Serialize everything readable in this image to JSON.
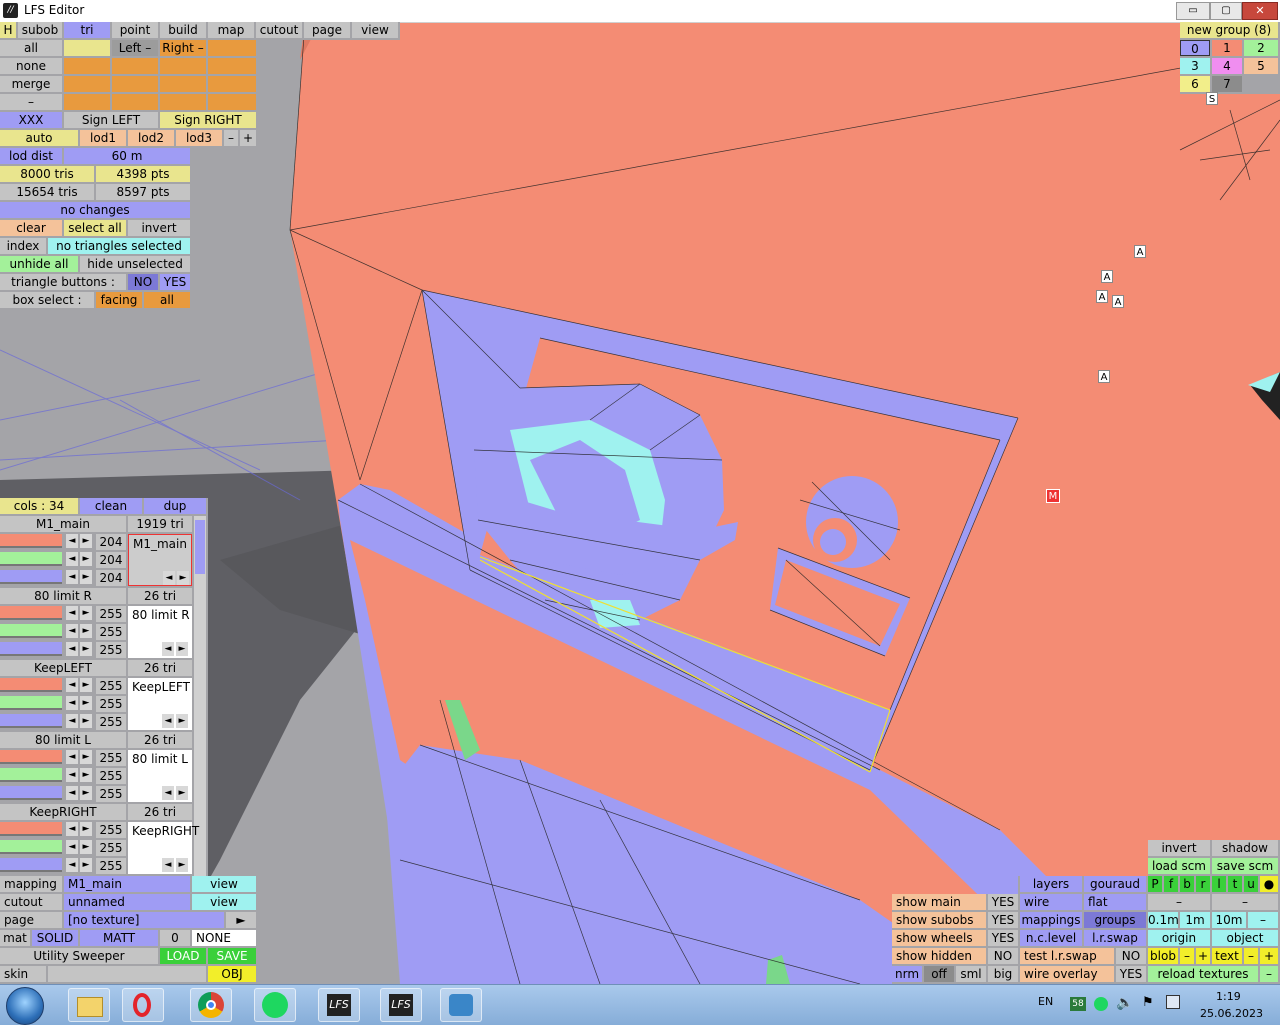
{
  "window": {
    "title": "LFS Editor",
    "minimize": "▭",
    "maximize": "▢",
    "close": "✕"
  },
  "top_tabs": [
    {
      "label": "H"
    },
    {
      "label": "subob"
    },
    {
      "label": "tri"
    },
    {
      "label": "point"
    },
    {
      "label": "build"
    },
    {
      "label": "map"
    },
    {
      "label": "cutout"
    },
    {
      "label": "page"
    },
    {
      "label": "view"
    }
  ],
  "select": {
    "all": "all",
    "none": "none",
    "merge": "merge",
    "dash": "–",
    "left": "Left –",
    "right": "Right –"
  },
  "sign": {
    "xxx": "XXX",
    "left": "Sign LEFT",
    "right": "Sign RIGHT"
  },
  "lod": {
    "auto": "auto",
    "lod1": "lod1",
    "lod2": "lod2",
    "lod3": "lod3",
    "minus": "–",
    "plus": "+",
    "dist_label": "lod dist",
    "dist_value": "60 m"
  },
  "stats": {
    "tris_limit": "8000 tris",
    "pts_limit": "4398 pts",
    "tris": "15654 tris",
    "pts": "8597 pts",
    "status": "no changes"
  },
  "tri_ops": {
    "clear": "clear",
    "select_all": "select all",
    "invert": "invert",
    "index": "index",
    "index_value": "no triangles selected",
    "unhide": "unhide all",
    "hide_unselected": "hide unselected",
    "tri_buttons": "triangle buttons :",
    "no": "NO",
    "yes": "YES",
    "box_select": "box select :",
    "facing": "facing",
    "all": "all"
  },
  "group_panel": {
    "title": "new group (8)",
    "groups": [
      "0",
      "1",
      "2",
      "3",
      "4",
      "5",
      "6",
      "7"
    ],
    "s_marker": "S"
  },
  "viewport_markers": {
    "a": "A",
    "m": "M"
  },
  "cols_bar": {
    "cols": "cols : 34",
    "clean": "clean",
    "dup": "dup"
  },
  "color_entries": [
    {
      "name": "M1_main",
      "tri": "1919 tri",
      "values": [
        "204",
        "204",
        "204"
      ],
      "preview": "M1_main"
    },
    {
      "name": "80 limit R",
      "tri": "26 tri",
      "values": [
        "255",
        "255",
        "255"
      ],
      "preview": "80 limit R"
    },
    {
      "name": "KeepLEFT",
      "tri": "26 tri",
      "values": [
        "255",
        "255",
        "255"
      ],
      "preview": "KeepLEFT"
    },
    {
      "name": "80 limit L",
      "tri": "26 tri",
      "values": [
        "255",
        "255",
        "255"
      ],
      "preview": "80 limit L"
    },
    {
      "name": "KeepRIGHT",
      "tri": "26 tri",
      "values": [
        "255",
        "255",
        "255"
      ],
      "preview": "KeepRIGHT"
    }
  ],
  "mapping_panel": {
    "mapping_label": "mapping",
    "mapping_value": "M1_main",
    "view1": "view",
    "cutout_label": "cutout",
    "cutout_value": "unnamed",
    "view2": "view",
    "page_label": "page",
    "page_value": "[no texture]",
    "page_arrow": "►",
    "mat": "mat",
    "solid": "SOLID",
    "matt": "MATT",
    "zero": "0",
    "none": "NONE",
    "utility": "Utility Sweeper",
    "load": "LOAD",
    "save": "SAVE",
    "skin": "skin",
    "obj": "OBJ"
  },
  "view_panel": {
    "invert": "invert",
    "shadow": "shadow",
    "load_scm": "load scm",
    "save_scm": "save scm",
    "flags": [
      "P",
      "f",
      "b",
      "r",
      "l",
      "t",
      "u",
      "●"
    ],
    "layers": "layers",
    "gouraud": "gouraud",
    "dash1": "–",
    "dash2": "–",
    "show_main": "show main",
    "show_main_v": "YES",
    "wire": "wire",
    "flat": "flat",
    "show_subobs": "show subobs",
    "show_subobs_v": "YES",
    "mappings": "mappings",
    "groups": "groups",
    "d01": "0.1m",
    "d1": "1m",
    "d10": "10m",
    "dash3": "–",
    "show_wheels": "show wheels",
    "show_wheels_v": "YES",
    "nc_level": "n.c.level",
    "lr_swap": "l.r.swap",
    "origin": "origin",
    "object": "object",
    "show_hidden": "show hidden",
    "show_hidden_v": "NO",
    "test_lr_swap": "test l.r.swap",
    "test_lr_swap_v": "NO",
    "blob": "blob",
    "blob_minus": "–",
    "blob_plus": "+",
    "text": "text",
    "text_minus": "–",
    "text_plus": "+",
    "nrm": "nrm",
    "off": "off",
    "sml": "sml",
    "big": "big",
    "wire_overlay": "wire overlay",
    "wire_overlay_v": "YES",
    "reload": "reload textures",
    "dash4": "–"
  },
  "taskbar": {
    "lang": "EN",
    "badge": "58",
    "time": "1:19",
    "date": "25.06.2023",
    "apps": [
      "start-orb",
      "file-explorer",
      "opera",
      "chrome",
      "spotify",
      "lfs-editor-1",
      "lfs-editor-2",
      "lfs-tool"
    ]
  },
  "colors": {
    "body": "#f48c74",
    "selected": "#9f9cf4",
    "cyan": "#9ff2ef",
    "ground": "#5f5f64",
    "bg_gray": "#a4a4a8"
  }
}
